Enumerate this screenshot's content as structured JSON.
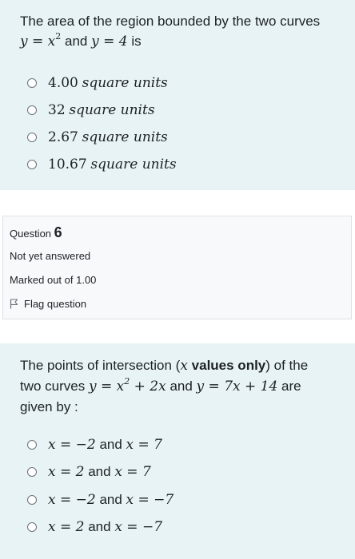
{
  "question5": {
    "text_intro": "The area of the region bounded by the two curves",
    "text_and": "and",
    "text_is": "is",
    "curve1": "y = x",
    "curve1_exp": "2",
    "curve2": "y = 4",
    "options": [
      {
        "num": "4.00",
        "unit": "square units"
      },
      {
        "num": "32",
        "unit": "square units"
      },
      {
        "num": "2.67",
        "unit": "square units"
      },
      {
        "num": "10.67",
        "unit": "square units"
      }
    ]
  },
  "info": {
    "question_label": "Question",
    "question_number": "6",
    "status": "Not yet answered",
    "marked": "Marked out of 1.00",
    "flag_label": "Flag question"
  },
  "question6": {
    "line1_a": "The points of intersection (",
    "line1_var": "x",
    "line1_bold": "values only",
    "line1_b": ") of the",
    "line2_a": "two curves",
    "curve1_a": "y = x",
    "curve1_exp": "2",
    "curve1_b": "+ 2x",
    "text_and": "and",
    "curve2": "y = 7x + 14",
    "line2_b": "are",
    "line3": "given by :",
    "options": [
      {
        "a": "x = −2",
        "b": "x = 7"
      },
      {
        "a": "x = 2",
        "b": "x = 7"
      },
      {
        "a": "x = −2",
        "b": "x = −7"
      },
      {
        "a": "x = 2",
        "b": "x = −7"
      }
    ],
    "option_and": "and"
  }
}
